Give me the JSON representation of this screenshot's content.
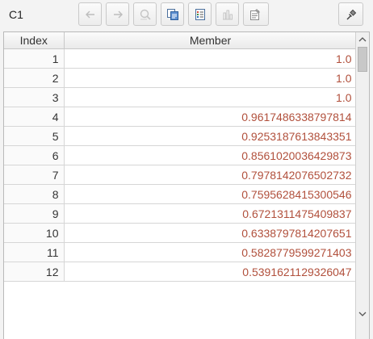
{
  "toolbar": {
    "cell_name": "C1",
    "buttons": [
      {
        "icon": "back-arrow-icon",
        "enabled": false
      },
      {
        "icon": "forward-arrow-icon",
        "enabled": false
      },
      {
        "icon": "magnifier-icon",
        "enabled": false
      },
      {
        "icon": "copy-icon",
        "enabled": true
      },
      {
        "icon": "list-icon",
        "enabled": true
      },
      {
        "icon": "chart-icon",
        "enabled": false
      },
      {
        "icon": "properties-icon",
        "enabled": true
      },
      {
        "icon": "pin-icon",
        "enabled": true
      }
    ]
  },
  "grid": {
    "headers": {
      "index": "Index",
      "member": "Member"
    },
    "rows": [
      {
        "index": "1",
        "member": "1.0"
      },
      {
        "index": "2",
        "member": "1.0"
      },
      {
        "index": "3",
        "member": "1.0"
      },
      {
        "index": "4",
        "member": "0.9617486338797814"
      },
      {
        "index": "5",
        "member": "0.9253187613843351"
      },
      {
        "index": "6",
        "member": "0.8561020036429873"
      },
      {
        "index": "7",
        "member": "0.7978142076502732"
      },
      {
        "index": "8",
        "member": "0.7595628415300546"
      },
      {
        "index": "9",
        "member": "0.6721311475409837"
      },
      {
        "index": "10",
        "member": "0.6338797814207651"
      },
      {
        "index": "11",
        "member": "0.5828779599271403"
      },
      {
        "index": "12",
        "member": "0.5391621129326047"
      }
    ]
  },
  "colors": {
    "value_text": "#b1503c",
    "accent_blue": "#2f6fb5"
  }
}
